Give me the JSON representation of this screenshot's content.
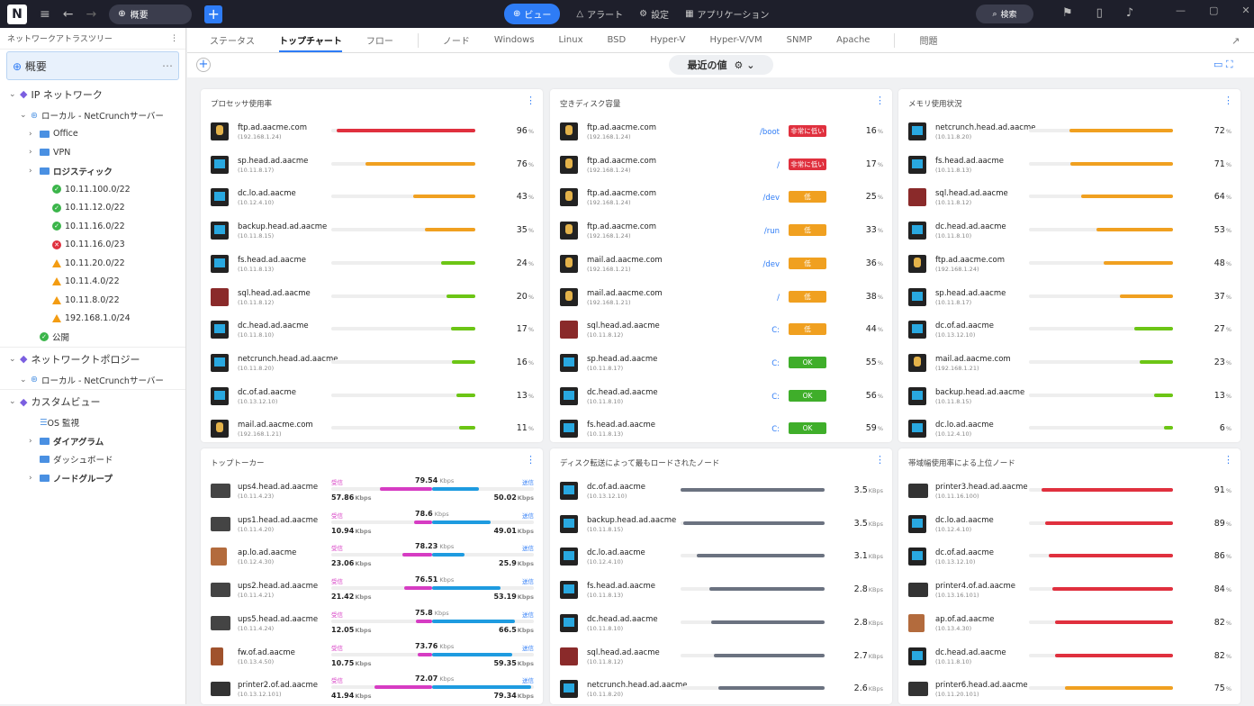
{
  "app": {
    "logo": "N",
    "overview_pill": "概要"
  },
  "topnav": [
    {
      "label": "ビュー",
      "icon": "globe-icon",
      "active": true
    },
    {
      "label": "アラート",
      "icon": "bell-icon"
    },
    {
      "label": "設定",
      "icon": "gear-icon"
    },
    {
      "label": "アプリケーション",
      "icon": "grid-icon"
    }
  ],
  "search_label": "検索",
  "sidebar": {
    "title": "ネットワークアトラスツリー",
    "overview": "概要",
    "tree": [
      {
        "t": "sec",
        "label": "IP ネットワーク",
        "indent": 0
      },
      {
        "t": "net",
        "label": "ローカル - NetCrunchサーバー",
        "indent": 1
      },
      {
        "t": "folder",
        "label": "Office",
        "indent": 2
      },
      {
        "t": "folder",
        "label": "VPN",
        "indent": 2
      },
      {
        "t": "folder",
        "label": "ロジスティック",
        "indent": 2,
        "bold": true
      },
      {
        "t": "ok",
        "label": "10.11.100.0/22",
        "indent": 3
      },
      {
        "t": "ok",
        "label": "10.11.12.0/22",
        "indent": 3
      },
      {
        "t": "ok",
        "label": "10.11.16.0/22",
        "indent": 3
      },
      {
        "t": "err",
        "label": "10.11.16.0/23",
        "indent": 3
      },
      {
        "t": "warn",
        "label": "10.11.20.0/22",
        "indent": 3
      },
      {
        "t": "warn",
        "label": "10.11.4.0/22",
        "indent": 3
      },
      {
        "t": "warn",
        "label": "10.11.8.0/22",
        "indent": 3
      },
      {
        "t": "warn",
        "label": "192.168.1.0/24",
        "indent": 3
      },
      {
        "t": "ok",
        "label": "公開",
        "indent": 2
      },
      {
        "t": "sec",
        "label": "ネットワークトポロジー",
        "indent": 0
      },
      {
        "t": "net",
        "label": "ローカル - NetCrunchサーバー",
        "indent": 1
      },
      {
        "t": "sec",
        "label": "カスタムビュー",
        "indent": 0
      },
      {
        "t": "list",
        "label": "OS 監視",
        "indent": 2
      },
      {
        "t": "folder",
        "label": "ダイアグラム",
        "indent": 2,
        "bold": true,
        "chev": true
      },
      {
        "t": "folder",
        "label": "ダッシュボード",
        "indent": 2
      },
      {
        "t": "folder",
        "label": "ノードグループ",
        "indent": 2,
        "bold": true,
        "chev": true
      }
    ]
  },
  "tabs": [
    "ステータス",
    "トップチャート",
    "フロー",
    "|",
    "ノード",
    "Windows",
    "Linux",
    "BSD",
    "Hyper-V",
    "Hyper-V/VM",
    "SNMP",
    "Apache",
    "|",
    "問題"
  ],
  "active_tab": "トップチャート",
  "view_button": "最近の値",
  "panels": {
    "cpu": {
      "title": "プロセッサ使用率",
      "rows": [
        {
          "name": "ftp.ad.aacme.com",
          "ip": "(192.168.1.24)",
          "icon": "linux",
          "pct": 96,
          "color": "#e0303e"
        },
        {
          "name": "sp.head.ad.aacme",
          "ip": "(10.11.8.17)",
          "icon": "win",
          "pct": 76,
          "color": "#f0a020"
        },
        {
          "name": "dc.lo.ad.aacme",
          "ip": "(10.12.4.10)",
          "icon": "win",
          "pct": 43,
          "color": "#f0a020"
        },
        {
          "name": "backup.head.ad.aacme",
          "ip": "(10.11.8.15)",
          "icon": "win",
          "pct": 35,
          "color": "#f0a020"
        },
        {
          "name": "fs.head.ad.aacme",
          "ip": "(10.11.8.13)",
          "icon": "win",
          "pct": 24,
          "color": "#6cc515"
        },
        {
          "name": "sql.head.ad.aacme",
          "ip": "(10.11.8.12)",
          "icon": "sql",
          "pct": 20,
          "color": "#6cc515"
        },
        {
          "name": "dc.head.ad.aacme",
          "ip": "(10.11.8.10)",
          "icon": "win",
          "pct": 17,
          "color": "#6cc515"
        },
        {
          "name": "netcrunch.head.ad.aacme",
          "ip": "(10.11.8.20)",
          "icon": "win",
          "pct": 16,
          "color": "#6cc515"
        },
        {
          "name": "dc.of.ad.aacme",
          "ip": "(10.13.12.10)",
          "icon": "win",
          "pct": 13,
          "color": "#6cc515"
        },
        {
          "name": "mail.ad.aacme.com",
          "ip": "(192.168.1.21)",
          "icon": "linux",
          "pct": 11,
          "color": "#6cc515"
        }
      ]
    },
    "disk": {
      "title": "空きディスク容量",
      "rows": [
        {
          "name": "ftp.ad.aacme.com",
          "ip": "(192.168.1.24)",
          "icon": "linux",
          "path": "/boot",
          "badge": "非常に低い",
          "bcolor": "#e0303e",
          "pct": 16
        },
        {
          "name": "ftp.ad.aacme.com",
          "ip": "(192.168.1.24)",
          "icon": "linux",
          "path": "/",
          "badge": "非常に低い",
          "bcolor": "#e0303e",
          "pct": 17
        },
        {
          "name": "ftp.ad.aacme.com",
          "ip": "(192.168.1.24)",
          "icon": "linux",
          "path": "/dev",
          "badge": "低",
          "bcolor": "#f0a020",
          "pct": 25
        },
        {
          "name": "ftp.ad.aacme.com",
          "ip": "(192.168.1.24)",
          "icon": "linux",
          "path": "/run",
          "badge": "低",
          "bcolor": "#f0a020",
          "pct": 33
        },
        {
          "name": "mail.ad.aacme.com",
          "ip": "(192.168.1.21)",
          "icon": "linux",
          "path": "/dev",
          "badge": "低",
          "bcolor": "#f0a020",
          "pct": 36
        },
        {
          "name": "mail.ad.aacme.com",
          "ip": "(192.168.1.21)",
          "icon": "linux",
          "path": "/",
          "badge": "低",
          "bcolor": "#f0a020",
          "pct": 38
        },
        {
          "name": "sql.head.ad.aacme",
          "ip": "(10.11.8.12)",
          "icon": "sql",
          "path": "C:",
          "badge": "低",
          "bcolor": "#f0a020",
          "pct": 44
        },
        {
          "name": "sp.head.ad.aacme",
          "ip": "(10.11.8.17)",
          "icon": "win",
          "path": "C:",
          "badge": "OK",
          "bcolor": "#3fae2a",
          "pct": 55
        },
        {
          "name": "dc.head.ad.aacme",
          "ip": "(10.11.8.10)",
          "icon": "win",
          "path": "C:",
          "badge": "OK",
          "bcolor": "#3fae2a",
          "pct": 56
        },
        {
          "name": "fs.head.ad.aacme",
          "ip": "(10.11.8.13)",
          "icon": "win",
          "path": "C:",
          "badge": "OK",
          "bcolor": "#3fae2a",
          "pct": 59
        }
      ]
    },
    "mem": {
      "title": "メモリ使用状況",
      "rows": [
        {
          "name": "netcrunch.head.ad.aacme",
          "ip": "(10.11.8.20)",
          "icon": "win",
          "pct": 72,
          "color": "#f0a020"
        },
        {
          "name": "fs.head.ad.aacme",
          "ip": "(10.11.8.13)",
          "icon": "win",
          "pct": 71,
          "color": "#f0a020"
        },
        {
          "name": "sql.head.ad.aacme",
          "ip": "(10.11.8.12)",
          "icon": "sql",
          "pct": 64,
          "color": "#f0a020"
        },
        {
          "name": "dc.head.ad.aacme",
          "ip": "(10.11.8.10)",
          "icon": "win",
          "pct": 53,
          "color": "#f0a020"
        },
        {
          "name": "ftp.ad.aacme.com",
          "ip": "(192.168.1.24)",
          "icon": "linux",
          "pct": 48,
          "color": "#f0a020"
        },
        {
          "name": "sp.head.ad.aacme",
          "ip": "(10.11.8.17)",
          "icon": "win",
          "pct": 37,
          "color": "#f0a020"
        },
        {
          "name": "dc.of.ad.aacme",
          "ip": "(10.13.12.10)",
          "icon": "win",
          "pct": 27,
          "color": "#6cc515"
        },
        {
          "name": "mail.ad.aacme.com",
          "ip": "(192.168.1.21)",
          "icon": "linux",
          "pct": 23,
          "color": "#6cc515"
        },
        {
          "name": "backup.head.ad.aacme",
          "ip": "(10.11.8.15)",
          "icon": "win",
          "pct": 13,
          "color": "#6cc515"
        },
        {
          "name": "dc.lo.ad.aacme",
          "ip": "(10.12.4.10)",
          "icon": "win",
          "pct": 6,
          "color": "#6cc515"
        }
      ]
    },
    "talkers": {
      "title": "トップトーカー",
      "rx_label": "受信",
      "tx_label": "送信",
      "unit": "Kbps",
      "rows": [
        {
          "name": "ups4.head.ad.aacme",
          "ip": "(10.11.4.23)",
          "icon": "ups",
          "total": "79.54",
          "rx": "57.86",
          "tx": "50.02",
          "rxf": 0.53,
          "txf": 0.47
        },
        {
          "name": "ups1.head.ad.aacme",
          "ip": "(10.11.4.20)",
          "icon": "ups",
          "total": "78.6",
          "rx": "10.94",
          "tx": "49.01",
          "rxf": 0.18,
          "txf": 0.59
        },
        {
          "name": "ap.lo.ad.aacme",
          "ip": "(10.12.4.30)",
          "icon": "ap",
          "total": "78.23",
          "rx": "23.06",
          "tx": "25.9",
          "rxf": 0.3,
          "txf": 0.33
        },
        {
          "name": "ups2.head.ad.aacme",
          "ip": "(10.11.4.21)",
          "icon": "ups",
          "total": "76.51",
          "rx": "21.42",
          "tx": "53.19",
          "rxf": 0.28,
          "txf": 0.69
        },
        {
          "name": "ups5.head.ad.aacme",
          "ip": "(10.11.4.24)",
          "icon": "ups",
          "total": "75.8",
          "rx": "12.05",
          "tx": "66.5",
          "rxf": 0.16,
          "txf": 0.84
        },
        {
          "name": "fw.of.ad.aacme",
          "ip": "(10.13.4.50)",
          "icon": "fw",
          "total": "73.76",
          "rx": "10.75",
          "tx": "59.35",
          "rxf": 0.15,
          "txf": 0.81
        },
        {
          "name": "printer2.of.ad.aacme",
          "ip": "(10.13.12.101)",
          "icon": "printer",
          "total": "72.07",
          "rx": "41.94",
          "tx": "79.34",
          "rxf": 0.58,
          "txf": 1.0
        }
      ]
    },
    "diskio": {
      "title": "ディスク転送によって最もロードされたノード",
      "unit": "KBps",
      "rows": [
        {
          "name": "dc.of.ad.aacme",
          "ip": "(10.13.12.10)",
          "icon": "win",
          "val": "3.5",
          "f": 1.0
        },
        {
          "name": "backup.head.ad.aacme",
          "ip": "(10.11.8.15)",
          "icon": "win",
          "val": "3.5",
          "f": 0.98
        },
        {
          "name": "dc.lo.ad.aacme",
          "ip": "(10.12.4.10)",
          "icon": "win",
          "val": "3.1",
          "f": 0.89
        },
        {
          "name": "fs.head.ad.aacme",
          "ip": "(10.11.8.13)",
          "icon": "win",
          "val": "2.8",
          "f": 0.8
        },
        {
          "name": "dc.head.ad.aacme",
          "ip": "(10.11.8.10)",
          "icon": "win",
          "val": "2.8",
          "f": 0.79
        },
        {
          "name": "sql.head.ad.aacme",
          "ip": "(10.11.8.12)",
          "icon": "sql",
          "val": "2.7",
          "f": 0.77
        },
        {
          "name": "netcrunch.head.ad.aacme",
          "ip": "(10.11.8.20)",
          "icon": "win",
          "val": "2.6",
          "f": 0.74
        }
      ]
    },
    "bw": {
      "title": "帯域幅使用率による上位ノード",
      "rows": [
        {
          "name": "printer3.head.ad.aacme",
          "ip": "(10.11.16.100)",
          "icon": "printer",
          "pct": 91,
          "color": "#e0303e"
        },
        {
          "name": "dc.lo.ad.aacme",
          "ip": "(10.12.4.10)",
          "icon": "win",
          "pct": 89,
          "color": "#e0303e"
        },
        {
          "name": "dc.of.ad.aacme",
          "ip": "(10.13.12.10)",
          "icon": "win",
          "pct": 86,
          "color": "#e0303e"
        },
        {
          "name": "printer4.of.ad.aacme",
          "ip": "(10.13.16.101)",
          "icon": "printer",
          "pct": 84,
          "color": "#e0303e"
        },
        {
          "name": "ap.of.ad.aacme",
          "ip": "(10.13.4.30)",
          "icon": "ap",
          "pct": 82,
          "color": "#e0303e"
        },
        {
          "name": "dc.head.ad.aacme",
          "ip": "(10.11.8.10)",
          "icon": "win",
          "pct": 82,
          "color": "#e0303e"
        },
        {
          "name": "printer6.head.ad.aacme",
          "ip": "(10.11.20.101)",
          "icon": "printer",
          "pct": 75,
          "color": "#f0a020"
        }
      ]
    }
  }
}
